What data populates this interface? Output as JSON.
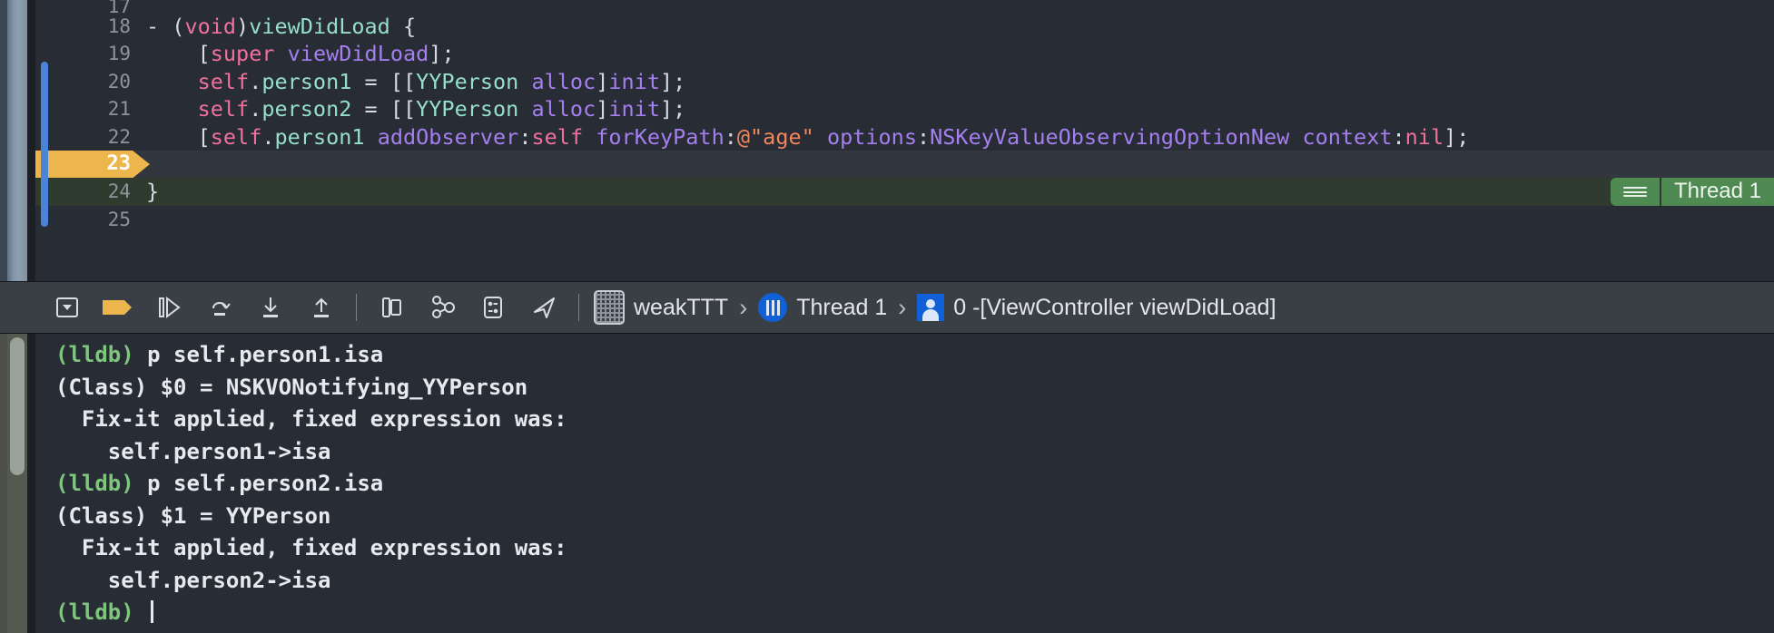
{
  "editor": {
    "lines": [
      {
        "num": "17",
        "partial": true,
        "state": "normal",
        "tokens": []
      },
      {
        "num": "18",
        "state": "normal",
        "tokens": [
          {
            "t": "- ",
            "c": "c-plain"
          },
          {
            "t": "(",
            "c": "c-plain"
          },
          {
            "t": "void",
            "c": "c-kw"
          },
          {
            "t": ")",
            "c": "c-plain"
          },
          {
            "t": "viewDidLoad",
            "c": "c-type"
          },
          {
            "t": " {",
            "c": "c-plain"
          }
        ]
      },
      {
        "num": "19",
        "state": "normal",
        "tokens": [
          {
            "t": "    [",
            "c": "c-plain"
          },
          {
            "t": "super",
            "c": "c-kw"
          },
          {
            "t": " ",
            "c": "c-plain"
          },
          {
            "t": "viewDidLoad",
            "c": "c-purple"
          },
          {
            "t": "];",
            "c": "c-plain"
          }
        ]
      },
      {
        "num": "20",
        "state": "normal",
        "tokens": [
          {
            "t": "    ",
            "c": "c-plain"
          },
          {
            "t": "self",
            "c": "c-pink"
          },
          {
            "t": ".",
            "c": "c-plain"
          },
          {
            "t": "person1",
            "c": "c-type"
          },
          {
            "t": " = [[",
            "c": "c-plain"
          },
          {
            "t": "YYPerson",
            "c": "c-type"
          },
          {
            "t": " ",
            "c": "c-plain"
          },
          {
            "t": "alloc",
            "c": "c-purple"
          },
          {
            "t": "]",
            "c": "c-plain"
          },
          {
            "t": "init",
            "c": "c-purple"
          },
          {
            "t": "];",
            "c": "c-plain"
          }
        ]
      },
      {
        "num": "21",
        "state": "normal",
        "tokens": [
          {
            "t": "    ",
            "c": "c-plain"
          },
          {
            "t": "self",
            "c": "c-pink"
          },
          {
            "t": ".",
            "c": "c-plain"
          },
          {
            "t": "person2",
            "c": "c-type"
          },
          {
            "t": " = [[",
            "c": "c-plain"
          },
          {
            "t": "YYPerson",
            "c": "c-type"
          },
          {
            "t": " ",
            "c": "c-plain"
          },
          {
            "t": "alloc",
            "c": "c-purple"
          },
          {
            "t": "]",
            "c": "c-plain"
          },
          {
            "t": "init",
            "c": "c-purple"
          },
          {
            "t": "];",
            "c": "c-plain"
          }
        ]
      },
      {
        "num": "22",
        "state": "normal",
        "tokens": [
          {
            "t": "    [",
            "c": "c-plain"
          },
          {
            "t": "self",
            "c": "c-pink"
          },
          {
            "t": ".",
            "c": "c-plain"
          },
          {
            "t": "person1",
            "c": "c-type"
          },
          {
            "t": " ",
            "c": "c-plain"
          },
          {
            "t": "addObserver",
            "c": "c-purple"
          },
          {
            "t": ":",
            "c": "c-plain"
          },
          {
            "t": "self",
            "c": "c-pink"
          },
          {
            "t": " ",
            "c": "c-plain"
          },
          {
            "t": "forKeyPath",
            "c": "c-purple"
          },
          {
            "t": ":",
            "c": "c-plain"
          },
          {
            "t": "@\"age\"",
            "c": "c-str"
          },
          {
            "t": " ",
            "c": "c-plain"
          },
          {
            "t": "options",
            "c": "c-purple"
          },
          {
            "t": ":",
            "c": "c-plain"
          },
          {
            "t": "NSKeyValueObservingOptionNew",
            "c": "c-purple"
          },
          {
            "t": " ",
            "c": "c-plain"
          },
          {
            "t": "context",
            "c": "c-purple"
          },
          {
            "t": ":",
            "c": "c-plain"
          },
          {
            "t": "nil",
            "c": "c-pink"
          },
          {
            "t": "];",
            "c": "c-plain"
          }
        ]
      },
      {
        "num": "23",
        "state": "current",
        "tokens": []
      },
      {
        "num": "24",
        "state": "green",
        "tokens": [
          {
            "t": "}",
            "c": "c-plain"
          }
        ],
        "badge": {
          "label": "Thread 1",
          "icon": "hamburger-icon",
          "color": "#4f8a52"
        }
      },
      {
        "num": "25",
        "state": "normal",
        "tokens": []
      }
    ]
  },
  "toolbar": {
    "icons": [
      {
        "name": "hide-debug-area-icon",
        "glyph": "hide-area"
      },
      {
        "name": "breakpoints-toggle-icon",
        "glyph": "breakpoint"
      },
      {
        "name": "continue-icon",
        "glyph": "continue"
      },
      {
        "name": "step-over-icon",
        "glyph": "step-over"
      },
      {
        "name": "step-into-icon",
        "glyph": "step-into"
      },
      {
        "name": "step-out-icon",
        "glyph": "step-out"
      },
      {
        "name": "divider",
        "glyph": "divider"
      },
      {
        "name": "debug-view-hierarchy-icon",
        "glyph": "view-hierarchy"
      },
      {
        "name": "debug-memory-graph-icon",
        "glyph": "memory-graph"
      },
      {
        "name": "environment-overrides-icon",
        "glyph": "environment"
      },
      {
        "name": "simulate-location-icon",
        "glyph": "location"
      },
      {
        "name": "divider",
        "glyph": "divider"
      }
    ],
    "breadcrumb": [
      {
        "name": "breadcrumb-project",
        "icon": "project-icon",
        "label": "weakTTT"
      },
      {
        "name": "breadcrumb-thread",
        "icon": "thread-icon",
        "label": "Thread 1"
      },
      {
        "name": "breadcrumb-frame",
        "icon": "frame-icon",
        "label": "0 -[ViewController viewDidLoad]"
      }
    ],
    "chevron": "›"
  },
  "console": {
    "lines": [
      {
        "prompt": "(lldb) ",
        "text": "p self.person1.isa"
      },
      {
        "prompt": "",
        "text": "(Class) $0 = NSKVONotifying_YYPerson"
      },
      {
        "prompt": "",
        "text": "  Fix-it applied, fixed expression was:"
      },
      {
        "prompt": "",
        "text": "    self.person1->isa"
      },
      {
        "prompt": "(lldb) ",
        "text": "p self.person2.isa"
      },
      {
        "prompt": "",
        "text": "(Class) $1 = YYPerson"
      },
      {
        "prompt": "",
        "text": "  Fix-it applied, fixed expression was:"
      },
      {
        "prompt": "",
        "text": "    self.person2->isa"
      },
      {
        "prompt": "(lldb) ",
        "text": "",
        "cursor": true
      }
    ]
  },
  "colors": {
    "editor_bg": "#282c34",
    "current_line_marker": "#edb64c",
    "thread_badge": "#4f8a52",
    "block_indicator": "#4a84d8",
    "prompt_green": "#7ec67e"
  }
}
